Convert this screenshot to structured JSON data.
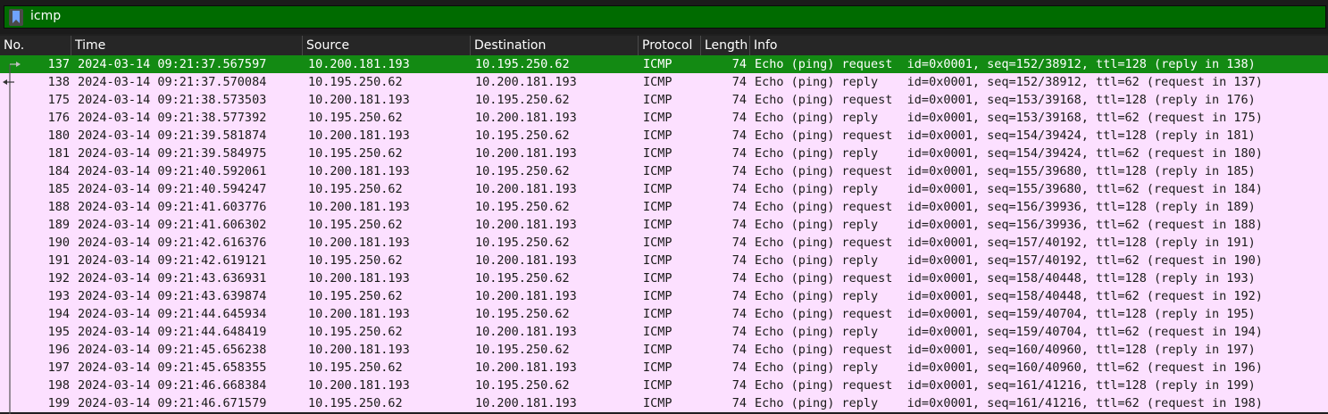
{
  "filter": {
    "value": "icmp",
    "icon": "bookmark-icon"
  },
  "columns": [
    "No.",
    "Time",
    "Source",
    "Destination",
    "Protocol",
    "Length",
    "Info"
  ],
  "colors": {
    "filter_bg": "#006b00",
    "row_bg": "#fce0ff",
    "selected_bg": "#138a13",
    "header_bg": "#262626"
  },
  "selected_index": 0,
  "rows": [
    {
      "no": "137",
      "time": "2024-03-14 09:21:37.567597",
      "src": "10.200.181.193",
      "dst": "10.195.250.62",
      "proto": "ICMP",
      "len": "74",
      "info": "Echo (ping) request  id=0x0001, seq=152/38912, ttl=128 (reply in 138)"
    },
    {
      "no": "138",
      "time": "2024-03-14 09:21:37.570084",
      "src": "10.195.250.62",
      "dst": "10.200.181.193",
      "proto": "ICMP",
      "len": "74",
      "info": "Echo (ping) reply    id=0x0001, seq=152/38912, ttl=62 (request in 137)"
    },
    {
      "no": "175",
      "time": "2024-03-14 09:21:38.573503",
      "src": "10.200.181.193",
      "dst": "10.195.250.62",
      "proto": "ICMP",
      "len": "74",
      "info": "Echo (ping) request  id=0x0001, seq=153/39168, ttl=128 (reply in 176)"
    },
    {
      "no": "176",
      "time": "2024-03-14 09:21:38.577392",
      "src": "10.195.250.62",
      "dst": "10.200.181.193",
      "proto": "ICMP",
      "len": "74",
      "info": "Echo (ping) reply    id=0x0001, seq=153/39168, ttl=62 (request in 175)"
    },
    {
      "no": "180",
      "time": "2024-03-14 09:21:39.581874",
      "src": "10.200.181.193",
      "dst": "10.195.250.62",
      "proto": "ICMP",
      "len": "74",
      "info": "Echo (ping) request  id=0x0001, seq=154/39424, ttl=128 (reply in 181)"
    },
    {
      "no": "181",
      "time": "2024-03-14 09:21:39.584975",
      "src": "10.195.250.62",
      "dst": "10.200.181.193",
      "proto": "ICMP",
      "len": "74",
      "info": "Echo (ping) reply    id=0x0001, seq=154/39424, ttl=62 (request in 180)"
    },
    {
      "no": "184",
      "time": "2024-03-14 09:21:40.592061",
      "src": "10.200.181.193",
      "dst": "10.195.250.62",
      "proto": "ICMP",
      "len": "74",
      "info": "Echo (ping) request  id=0x0001, seq=155/39680, ttl=128 (reply in 185)"
    },
    {
      "no": "185",
      "time": "2024-03-14 09:21:40.594247",
      "src": "10.195.250.62",
      "dst": "10.200.181.193",
      "proto": "ICMP",
      "len": "74",
      "info": "Echo (ping) reply    id=0x0001, seq=155/39680, ttl=62 (request in 184)"
    },
    {
      "no": "188",
      "time": "2024-03-14 09:21:41.603776",
      "src": "10.200.181.193",
      "dst": "10.195.250.62",
      "proto": "ICMP",
      "len": "74",
      "info": "Echo (ping) request  id=0x0001, seq=156/39936, ttl=128 (reply in 189)"
    },
    {
      "no": "189",
      "time": "2024-03-14 09:21:41.606302",
      "src": "10.195.250.62",
      "dst": "10.200.181.193",
      "proto": "ICMP",
      "len": "74",
      "info": "Echo (ping) reply    id=0x0001, seq=156/39936, ttl=62 (request in 188)"
    },
    {
      "no": "190",
      "time": "2024-03-14 09:21:42.616376",
      "src": "10.200.181.193",
      "dst": "10.195.250.62",
      "proto": "ICMP",
      "len": "74",
      "info": "Echo (ping) request  id=0x0001, seq=157/40192, ttl=128 (reply in 191)"
    },
    {
      "no": "191",
      "time": "2024-03-14 09:21:42.619121",
      "src": "10.195.250.62",
      "dst": "10.200.181.193",
      "proto": "ICMP",
      "len": "74",
      "info": "Echo (ping) reply    id=0x0001, seq=157/40192, ttl=62 (request in 190)"
    },
    {
      "no": "192",
      "time": "2024-03-14 09:21:43.636931",
      "src": "10.200.181.193",
      "dst": "10.195.250.62",
      "proto": "ICMP",
      "len": "74",
      "info": "Echo (ping) request  id=0x0001, seq=158/40448, ttl=128 (reply in 193)"
    },
    {
      "no": "193",
      "time": "2024-03-14 09:21:43.639874",
      "src": "10.195.250.62",
      "dst": "10.200.181.193",
      "proto": "ICMP",
      "len": "74",
      "info": "Echo (ping) reply    id=0x0001, seq=158/40448, ttl=62 (request in 192)"
    },
    {
      "no": "194",
      "time": "2024-03-14 09:21:44.645934",
      "src": "10.200.181.193",
      "dst": "10.195.250.62",
      "proto": "ICMP",
      "len": "74",
      "info": "Echo (ping) request  id=0x0001, seq=159/40704, ttl=128 (reply in 195)"
    },
    {
      "no": "195",
      "time": "2024-03-14 09:21:44.648419",
      "src": "10.195.250.62",
      "dst": "10.200.181.193",
      "proto": "ICMP",
      "len": "74",
      "info": "Echo (ping) reply    id=0x0001, seq=159/40704, ttl=62 (request in 194)"
    },
    {
      "no": "196",
      "time": "2024-03-14 09:21:45.656238",
      "src": "10.200.181.193",
      "dst": "10.195.250.62",
      "proto": "ICMP",
      "len": "74",
      "info": "Echo (ping) request  id=0x0001, seq=160/40960, ttl=128 (reply in 197)"
    },
    {
      "no": "197",
      "time": "2024-03-14 09:21:45.658355",
      "src": "10.195.250.62",
      "dst": "10.200.181.193",
      "proto": "ICMP",
      "len": "74",
      "info": "Echo (ping) reply    id=0x0001, seq=160/40960, ttl=62 (request in 196)"
    },
    {
      "no": "198",
      "time": "2024-03-14 09:21:46.668384",
      "src": "10.200.181.193",
      "dst": "10.195.250.62",
      "proto": "ICMP",
      "len": "74",
      "info": "Echo (ping) request  id=0x0001, seq=161/41216, ttl=128 (reply in 199)"
    },
    {
      "no": "199",
      "time": "2024-03-14 09:21:46.671579",
      "src": "10.195.250.62",
      "dst": "10.200.181.193",
      "proto": "ICMP",
      "len": "74",
      "info": "Echo (ping) reply    id=0x0001, seq=161/41216, ttl=62 (request in 198)"
    }
  ]
}
